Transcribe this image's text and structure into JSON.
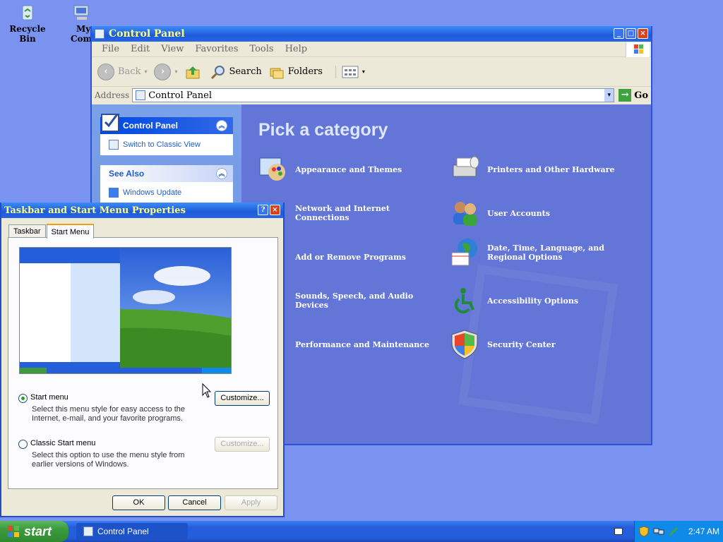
{
  "desktop": {
    "icons": [
      {
        "label": "Recycle Bin"
      },
      {
        "label_line1": "My",
        "label_line2": "Compu"
      }
    ]
  },
  "control_panel": {
    "title": "Control Panel",
    "menu": [
      "File",
      "Edit",
      "View",
      "Favorites",
      "Tools",
      "Help"
    ],
    "toolbar": {
      "back": "Back",
      "search": "Search",
      "folders": "Folders"
    },
    "address": {
      "label": "Address",
      "value": "Control Panel",
      "go": "Go"
    },
    "left_pane": {
      "box1_title": "Control Panel",
      "box1_link": "Switch to Classic View",
      "box2_title": "See Also",
      "box2_link": "Windows Update"
    },
    "heading": "Pick a category",
    "categories": [
      "Appearance and Themes",
      "Printers and Other Hardware",
      "Network and Internet Connections",
      "User Accounts",
      "Add or Remove Programs",
      "Date, Time, Language, and Regional Options",
      "Sounds, Speech, and Audio Devices",
      "Accessibility Options",
      "Performance and Maintenance",
      "Security Center"
    ]
  },
  "dialog": {
    "title": "Taskbar and Start Menu Properties",
    "tabs": [
      "Taskbar",
      "Start Menu"
    ],
    "option1": {
      "label": "Start menu",
      "desc": "Select this menu style for easy access to the Internet, e-mail, and your favorite programs.",
      "selected": true
    },
    "option2": {
      "label": "Classic Start menu",
      "desc": "Select this option to use the menu style from earlier versions of Windows.",
      "selected": false
    },
    "customize": "Customize...",
    "ok": "OK",
    "cancel": "Cancel",
    "apply": "Apply"
  },
  "taskbar": {
    "start": "start",
    "task": "Control Panel",
    "clock": "2:47 AM"
  }
}
